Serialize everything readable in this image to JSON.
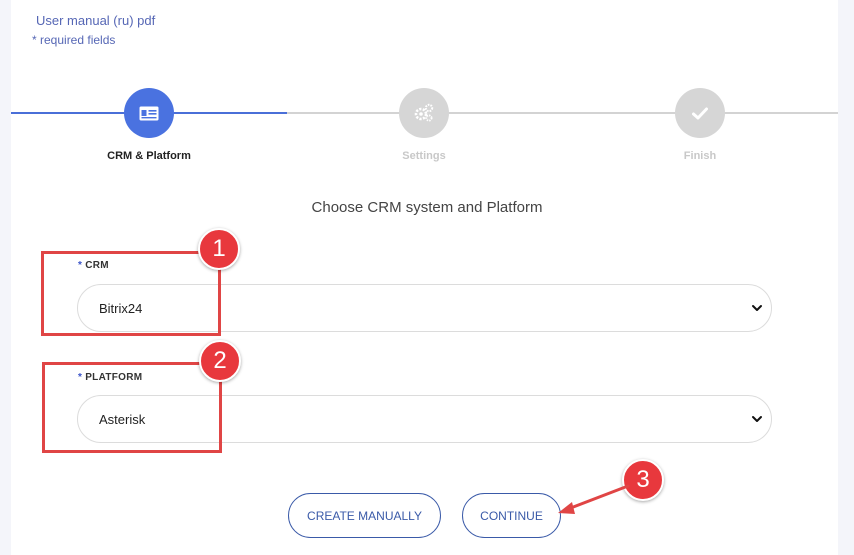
{
  "header": {
    "manual_link": "User manual (ru) pdf",
    "required_note": "* required fields"
  },
  "stepper": {
    "steps": [
      {
        "label": "CRM & Platform",
        "icon": "id-card-icon",
        "state": "active"
      },
      {
        "label": "Settings",
        "icon": "gears-icon",
        "state": "inactive"
      },
      {
        "label": "Finish",
        "icon": "check-icon",
        "state": "inactive"
      }
    ]
  },
  "main": {
    "heading": "Choose CRM system and Platform"
  },
  "form": {
    "required_star": "*",
    "crm": {
      "label": "CRM",
      "value": "Bitrix24"
    },
    "platform": {
      "label": "PLATFORM",
      "value": "Asterisk"
    }
  },
  "actions": {
    "create_manually": "CREATE MANUALLY",
    "continue": "CONTINUE"
  },
  "annotations": {
    "badges": [
      "1",
      "2",
      "3"
    ],
    "color": "#e8383d"
  },
  "colors": {
    "accent": "#4a72e0",
    "inactive_step": "#d6d6d6",
    "button_border": "#3a5aa8"
  }
}
